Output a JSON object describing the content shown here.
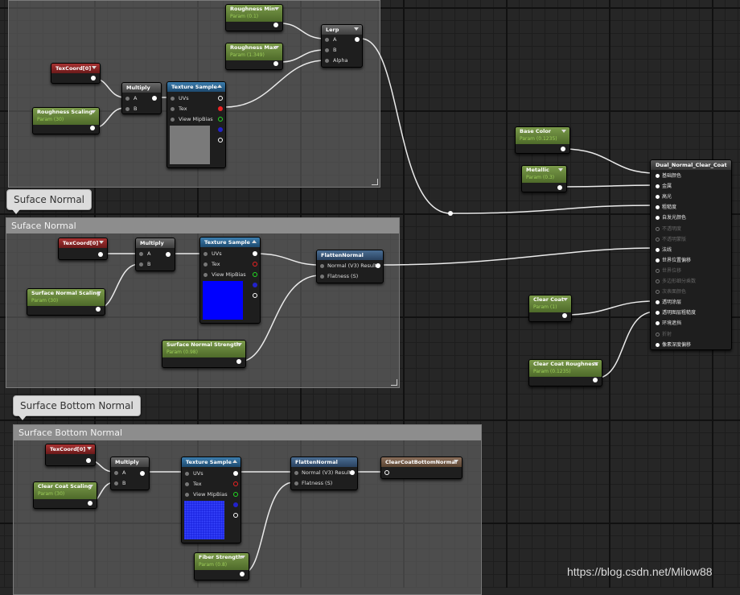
{
  "comments": {
    "roughness": {
      "title": ""
    },
    "surface_normal": {
      "title": "Suface Normal",
      "bubble": "Suface Normal"
    },
    "surface_bottom_normal": {
      "title": "Surface Bottom Normal",
      "bubble": "Surface Bottom Normal"
    }
  },
  "nodes": {
    "roughness_min": {
      "title": "Roughness Min",
      "sub": "Param (0.1)"
    },
    "roughness_max": {
      "title": "Roughness Max",
      "sub": "Param (1.349)"
    },
    "lerp": {
      "title": "Lerp",
      "pins": [
        "A",
        "B",
        "Alpha"
      ]
    },
    "texcoord_1": {
      "title": "TexCoord[0]"
    },
    "multiply_1": {
      "title": "Multiply",
      "pins": [
        "A",
        "B"
      ]
    },
    "texture_sample_1": {
      "title": "Texture Sample",
      "pins": [
        "UVs",
        "Tex",
        "View MipBias"
      ]
    },
    "roughness_scaling": {
      "title": "Roughness Scaling",
      "sub": "Param (30)"
    },
    "base_color": {
      "title": "Base Color",
      "sub": "Param (0.1235)"
    },
    "metallic": {
      "title": "Metallic",
      "sub": "Param (0.3)"
    },
    "texcoord_2": {
      "title": "TexCoord[0]"
    },
    "multiply_2": {
      "title": "Multiply",
      "pins": [
        "A",
        "B"
      ]
    },
    "texture_sample_2": {
      "title": "Texture Sample",
      "pins": [
        "UVs",
        "Tex",
        "View MipBias"
      ]
    },
    "flatten_normal_1": {
      "title": "FlattenNormal",
      "pins": [
        "Normal (V3) Result",
        "Flatness (S)"
      ]
    },
    "surface_normal_scaling": {
      "title": "Surface Normal Scaling",
      "sub": "Param (30)"
    },
    "surface_normal_strength": {
      "title": "Surface Normal Strength",
      "sub": "Param (0.98)"
    },
    "clear_coat": {
      "title": "Clear Coat",
      "sub": "Param (1)"
    },
    "clear_coat_roughness": {
      "title": "Clear Coat Roughness",
      "sub": "Param (0.1235)"
    },
    "texcoord_3": {
      "title": "TexCoord[0]"
    },
    "multiply_3": {
      "title": "Multiply",
      "pins": [
        "A",
        "B"
      ]
    },
    "clear_coat_scaling": {
      "title": "Clear Coat Scaling",
      "sub": "Param (30)"
    },
    "texture_sample_3": {
      "title": "Texture Sample",
      "pins": [
        "UVs",
        "Tex",
        "View MipBias"
      ]
    },
    "flatten_normal_2": {
      "title": "FlattenNormal",
      "pins": [
        "Normal (V3) Result",
        "Flatness (S)"
      ]
    },
    "clear_coat_bottom_normal": {
      "title": "ClearCoatBottomNormal"
    },
    "fiber_strength": {
      "title": "Fiber Strength",
      "sub": "Param (0.8)"
    },
    "material": {
      "title": "Dual_Normal_Clear_Coat",
      "pins": [
        "基础颜色",
        "金属",
        "高光",
        "粗糙度",
        "自发光颜色",
        "不透明度",
        "不透明蒙版",
        "法线",
        "世界位置偏移",
        "世界位移",
        "多边形细分乘数",
        "次表面颜色",
        "透明涂层",
        "透明图层粗糙度",
        "环境遮挡",
        "折射",
        "像素深度偏移"
      ],
      "disabled": [
        5,
        6,
        9,
        10,
        11,
        15
      ]
    }
  },
  "watermark": "https://blog.csdn.net/Milow88"
}
